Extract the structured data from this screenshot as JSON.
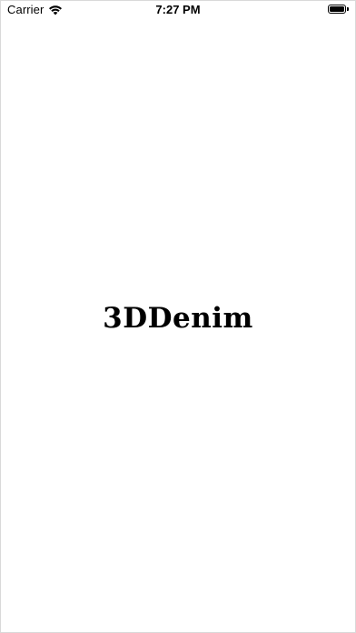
{
  "status_bar": {
    "carrier": "Carrier",
    "time": "7:27 PM",
    "wifi_icon": "wifi-icon",
    "battery_icon": "battery-icon",
    "battery_level": 1.0
  },
  "splash": {
    "title": "3DDenim"
  },
  "colors": {
    "background": "#ffffff",
    "text": "#000000"
  }
}
